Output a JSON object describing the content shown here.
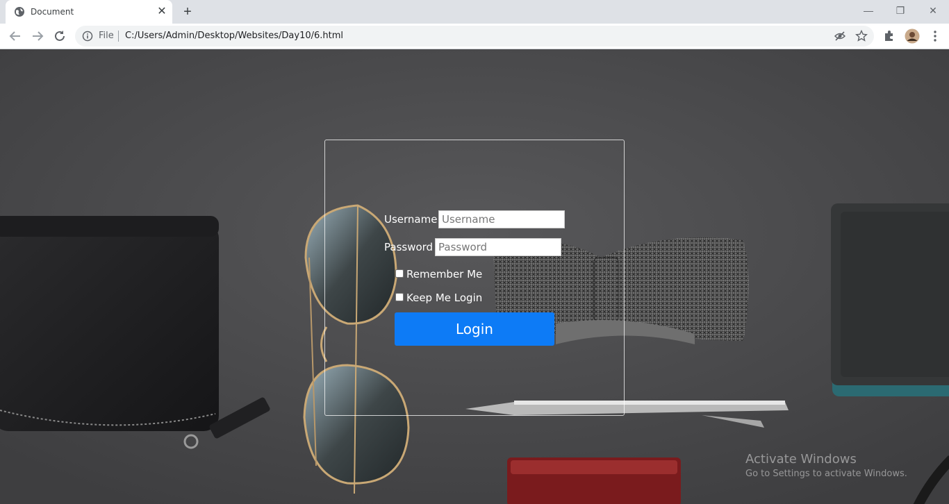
{
  "browser": {
    "tab_title": "Document",
    "file_label": "File",
    "url": "C:/Users/Admin/Desktop/Websites/Day10/6.html"
  },
  "login": {
    "username_label": "Username :",
    "username_placeholder": "Username",
    "password_label": "Password :",
    "password_placeholder": "Password",
    "remember_label": "Remember Me",
    "keep_label": "Keep Me Login",
    "button_label": "Login"
  },
  "watermark": {
    "title": "Activate Windows",
    "subtitle": "Go to Settings to activate Windows."
  },
  "colors": {
    "button": "#0d7bf6",
    "page_bg": "#4a4a4c",
    "chrome_bg": "#dee1e6"
  }
}
